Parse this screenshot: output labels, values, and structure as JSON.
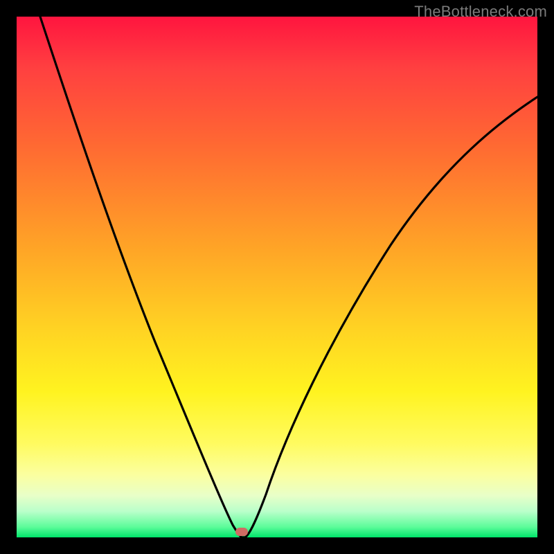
{
  "watermark": "TheBottleneck.com",
  "marker": {
    "x_frac": 0.432,
    "y_frac": 0.992
  },
  "colors": {
    "frame": "#000000",
    "curve": "#000000",
    "marker": "#cf6b63",
    "watermark": "#7b7b7b"
  },
  "chart_data": {
    "type": "line",
    "title": "",
    "xlabel": "",
    "ylabel": "",
    "xlim": [
      0,
      1
    ],
    "ylim": [
      0,
      1
    ],
    "series": [
      {
        "name": "bottleneck-curve",
        "x": [
          0.045,
          0.1,
          0.15,
          0.2,
          0.25,
          0.3,
          0.35,
          0.4,
          0.415,
          0.432,
          0.445,
          0.46,
          0.5,
          0.55,
          0.6,
          0.65,
          0.7,
          0.75,
          0.8,
          0.85,
          0.9,
          0.95,
          1.0
        ],
        "values": [
          1.0,
          0.86,
          0.735,
          0.61,
          0.49,
          0.375,
          0.265,
          0.1,
          0.045,
          0.0,
          0.035,
          0.085,
          0.185,
          0.29,
          0.38,
          0.46,
          0.53,
          0.595,
          0.655,
          0.71,
          0.76,
          0.805,
          0.845
        ]
      }
    ],
    "annotations": [
      {
        "type": "marker",
        "x": 0.432,
        "y": 0.0,
        "label": "optimal-point"
      }
    ]
  }
}
